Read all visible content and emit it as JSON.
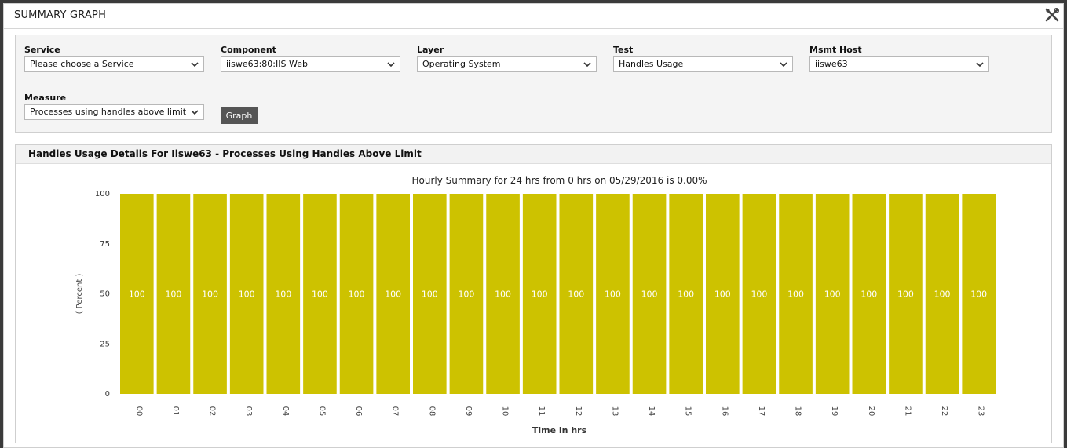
{
  "window": {
    "title": "SUMMARY GRAPH",
    "tools_icon": "tools-icon"
  },
  "filters": {
    "service": {
      "label": "Service",
      "value": "Please choose a Service"
    },
    "component": {
      "label": "Component",
      "value": "iiswe63:80:IIS Web"
    },
    "layer": {
      "label": "Layer",
      "value": "Operating System"
    },
    "test": {
      "label": "Test",
      "value": "Handles Usage"
    },
    "host": {
      "label": "Msmt Host",
      "value": "iiswe63"
    },
    "measure": {
      "label": "Measure",
      "value": "Processes using handles above limit"
    },
    "graph_label": "Graph"
  },
  "graph_panel": {
    "title": "Handles Usage Details For Iiswe63 - Processes Using Handles Above Limit"
  },
  "colors": {
    "bar": "#cdc200",
    "bar_label": "#ffffff",
    "accent_button": "#555555"
  },
  "chart_data": {
    "type": "bar",
    "title": "Hourly Summary for 24 hrs from 0 hrs on 05/29/2016 is 0.00%",
    "xlabel": "Time in hrs",
    "ylabel": "( Percent )",
    "categories": [
      "00",
      "01",
      "02",
      "03",
      "04",
      "05",
      "06",
      "07",
      "08",
      "09",
      "10",
      "11",
      "12",
      "13",
      "14",
      "15",
      "16",
      "17",
      "18",
      "19",
      "20",
      "21",
      "22",
      "23"
    ],
    "values": [
      100,
      100,
      100,
      100,
      100,
      100,
      100,
      100,
      100,
      100,
      100,
      100,
      100,
      100,
      100,
      100,
      100,
      100,
      100,
      100,
      100,
      100,
      100,
      100
    ],
    "ylim": [
      0,
      100
    ],
    "yticks": [
      0,
      25,
      50,
      75,
      100
    ],
    "data_labels": true,
    "grid": false,
    "legend": "none"
  }
}
